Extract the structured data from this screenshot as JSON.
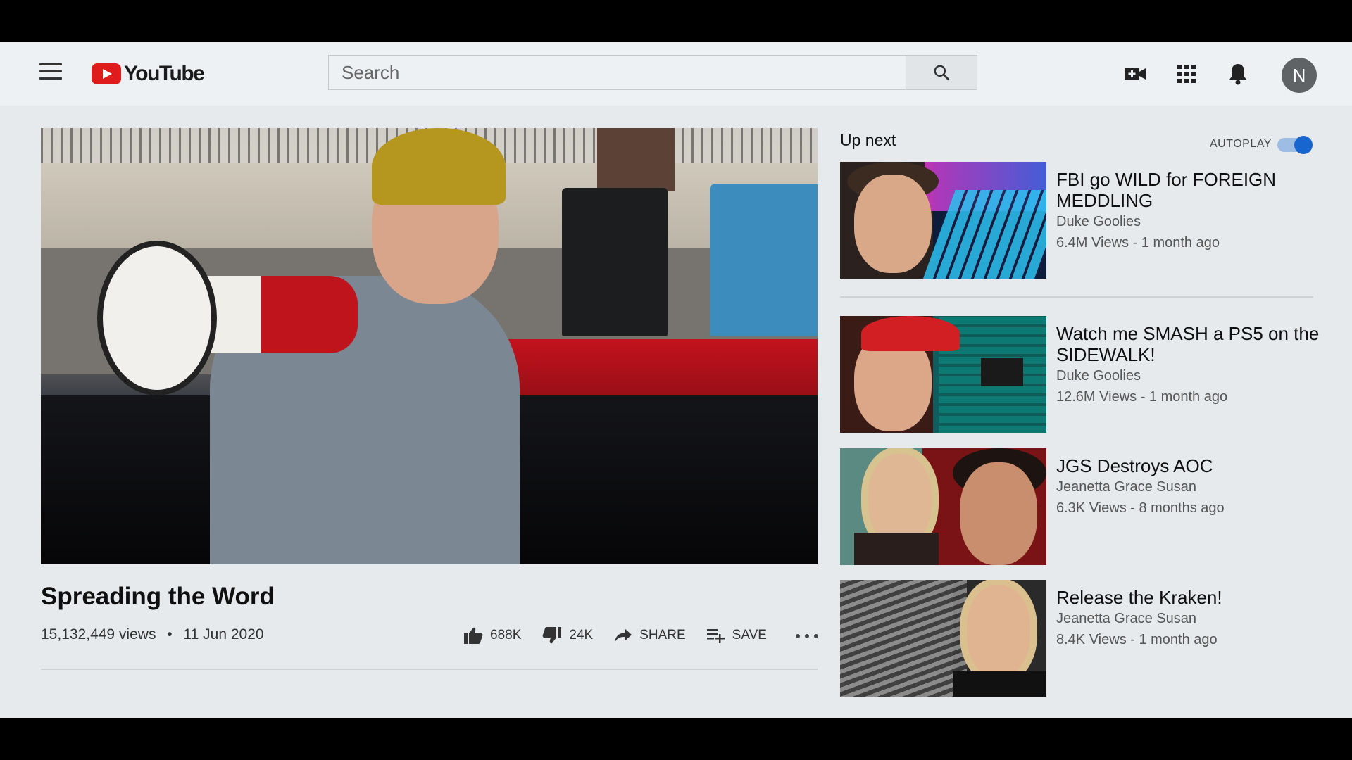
{
  "header": {
    "logo_text": "YouTube",
    "search_placeholder": "Search",
    "avatar_initial": "N"
  },
  "video": {
    "title": "Spreading the Word",
    "views": "15,132,449 views",
    "separator": "•",
    "date": "11 Jun 2020",
    "likes": "688K",
    "dislikes": "24K",
    "share_label": "SHARE",
    "save_label": "SAVE"
  },
  "sidebar": {
    "up_next_label": "Up next",
    "autoplay_label": "AUTOPLAY",
    "autoplay_on": true,
    "items": [
      {
        "title": "FBI go WILD for FOREIGN MEDDLING",
        "channel": "Duke Goolies",
        "stats": "6.4M Views - 1 month ago"
      },
      {
        "title": "Watch me SMASH a PS5 on the SIDEWALK!",
        "channel": "Duke Goolies",
        "stats": "12.6M Views - 1 month ago"
      },
      {
        "title": "JGS Destroys AOC",
        "channel": "Jeanetta Grace Susan",
        "stats": "6.3K Views - 8 months ago"
      },
      {
        "title": "Release the Kraken!",
        "channel": "Jeanetta Grace Susan",
        "stats": "8.4K Views - 1 month ago"
      }
    ]
  },
  "colors": {
    "brand_red": "#e01b1b",
    "page_background": "#e6eaed",
    "toggle_blue": "#1765cf"
  },
  "icons": [
    "menu-icon",
    "youtube-logo-icon",
    "search-icon",
    "create-video-icon",
    "apps-grid-icon",
    "notifications-bell-icon",
    "thumbs-up-icon",
    "thumbs-down-icon",
    "share-arrow-icon",
    "save-playlist-icon",
    "more-actions-icon"
  ]
}
